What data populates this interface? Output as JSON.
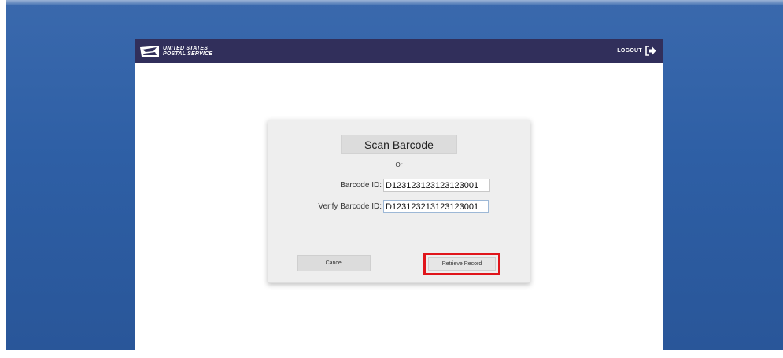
{
  "header": {
    "brand_line1": "UNITED STATES",
    "brand_line2": "POSTAL SERVICE",
    "logout_label": "LOGOUT",
    "logout_icon": "logout-arrow-icon",
    "logo_icon": "eagle-logo-icon"
  },
  "dialog": {
    "scan_label": "Scan Barcode",
    "or_text": "Or",
    "barcode_label": "Barcode ID:",
    "barcode_value": "D123123123123123001",
    "verify_label": "Verify Barcode ID:",
    "verify_value": "D123123213123123001",
    "cancel_label": "Cancel",
    "retrieve_label": "Retrieve Record"
  },
  "colors": {
    "background": "#2e5fa5",
    "header": "#312f5b",
    "highlight": "#e0151b"
  }
}
